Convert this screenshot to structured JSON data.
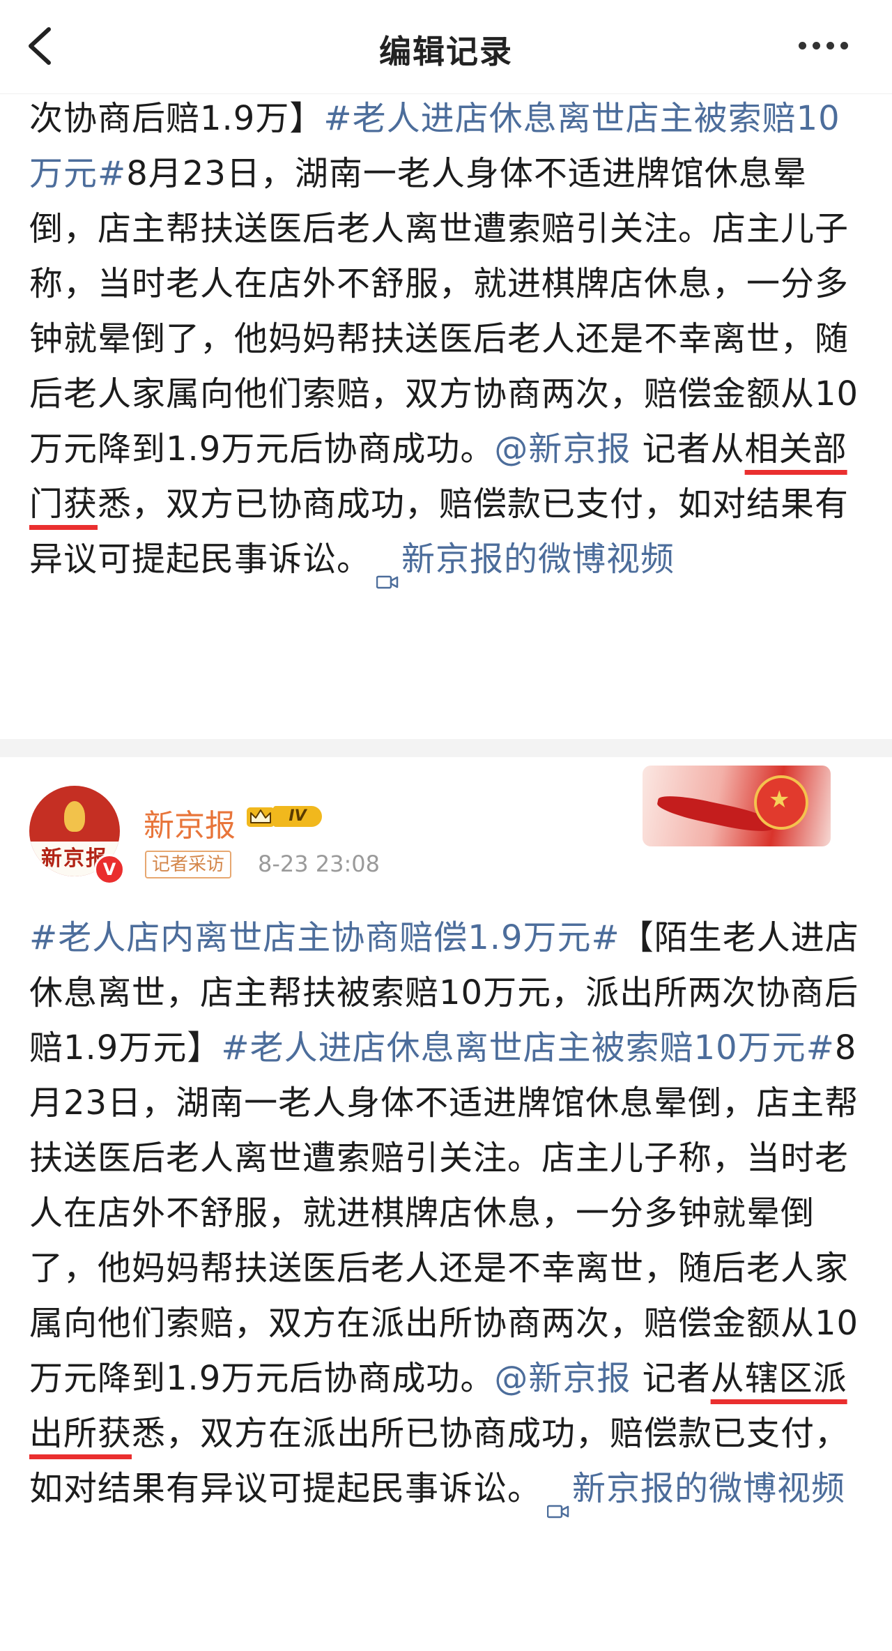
{
  "nav": {
    "title": "编辑记录"
  },
  "post1": {
    "text_a": "次协商后赔1.9万】",
    "hashtag": "#老人进店休息离世店主被索赔10万元#",
    "text_b": "8月23日，湖南一老人身体不适进牌馆休息晕倒，店主帮扶送医后老人离世遭索赔引关注。店主儿子称，当时老人在店外不舒服，就进棋牌店休息，一分多钟就晕倒了，他妈妈帮扶送医后老人还是不幸离世，随后老人家属向他们索赔，双方协商两次，赔偿金额从10万元降到1.9万元后协商成功。",
    "mention": "@新京报",
    "text_c": " 记者从",
    "highlight": "相关部门获",
    "text_d": "悉，双方已协商成功，赔偿款已支付，如对结果有异议可提起民事诉讼。",
    "video_link": "新京报的微博视频"
  },
  "post2": {
    "author": "新京报",
    "level": "IV",
    "avatar_text": "新京报",
    "verified_mark": "V",
    "source_tag": "记者采访",
    "timestamp": "8-23 23:08",
    "hashtag1": "#老人店内离世店主协商赔偿1.9万元#",
    "text_a": "【陌生老人进店休息离世，店主帮扶被索赔10万元，派出所两次协商后赔1.9万元】",
    "hashtag2": "#老人进店休息离世店主被索赔10万元#",
    "text_b": "8月23日，湖南一老人身体不适进牌馆休息晕倒，店主帮扶送医后老人离世遭索赔引关注。店主儿子称，当时老人在店外不舒服，就进棋牌店休息，一分多钟就晕倒了，他妈妈帮扶送医后老人还是不幸离世，随后老人家属向他们索赔，双方在派出所协商两次，赔偿金额从10万元降到1.9万元后协商成功。",
    "mention": "@新京报",
    "text_c": " 记者",
    "highlight": "从辖区派出所获",
    "text_d": "悉，双方在派出所已协商成功，赔偿款已支付，如对结果有异议可提起民事诉讼。",
    "video_link": "新京报的微博视频"
  },
  "colors": {
    "link": "#4c6d9b",
    "highlight_underline": "#ea2f2f",
    "username": "#e8753a"
  },
  "icons": {
    "back": "chevron-left-icon",
    "more": "more-dots-icon",
    "video": "video-camera-icon",
    "level": "crown-level-badge-icon"
  }
}
